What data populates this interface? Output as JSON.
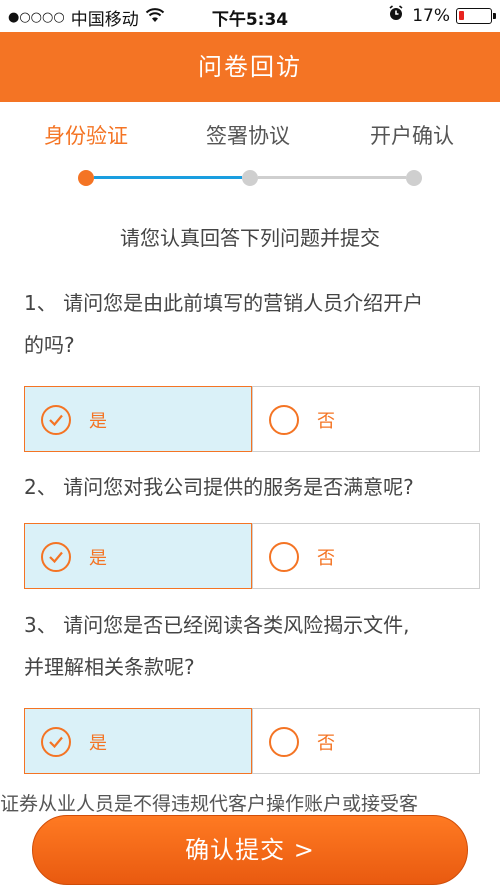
{
  "status_bar": {
    "signal_dots": "●○○○○",
    "carrier": "中国移动",
    "time": "下午5:34",
    "battery_percent": "17%",
    "battery_level": 0.17,
    "icons": [
      "wifi-icon",
      "alarm-icon",
      "battery-icon"
    ]
  },
  "header": {
    "title": "问卷回访"
  },
  "steps": {
    "items": [
      {
        "label": "身份验证",
        "active": true
      },
      {
        "label": "签署协议",
        "active": false
      },
      {
        "label": "开户确认",
        "active": false
      }
    ]
  },
  "prompt": "请您认真回答下列问题并提交",
  "questions": [
    {
      "line1": "1、 请问您是由此前填写的营销人员介绍开户",
      "line2": "的吗?",
      "yes": "是",
      "no": "否",
      "selected": "yes"
    },
    {
      "line1": "2、 请问您对我公司提供的服务是否满意呢?",
      "yes": "是",
      "no": "否",
      "selected": "yes"
    },
    {
      "line1": "3、 请问您是否已经阅读各类风险揭示文件,",
      "line2": "并理解相关条款呢?",
      "yes": "是",
      "no": "否",
      "selected": "yes"
    }
  ],
  "notice": "证券从业人员是不得违规代客户操作账户或接受客",
  "submit": {
    "label": "确认提交 >"
  },
  "colors": {
    "accent": "#f47424",
    "selected_bg": "#daf1f8",
    "progress_blue": "#1a9ee0",
    "inactive_gray": "#cfcfcf"
  }
}
